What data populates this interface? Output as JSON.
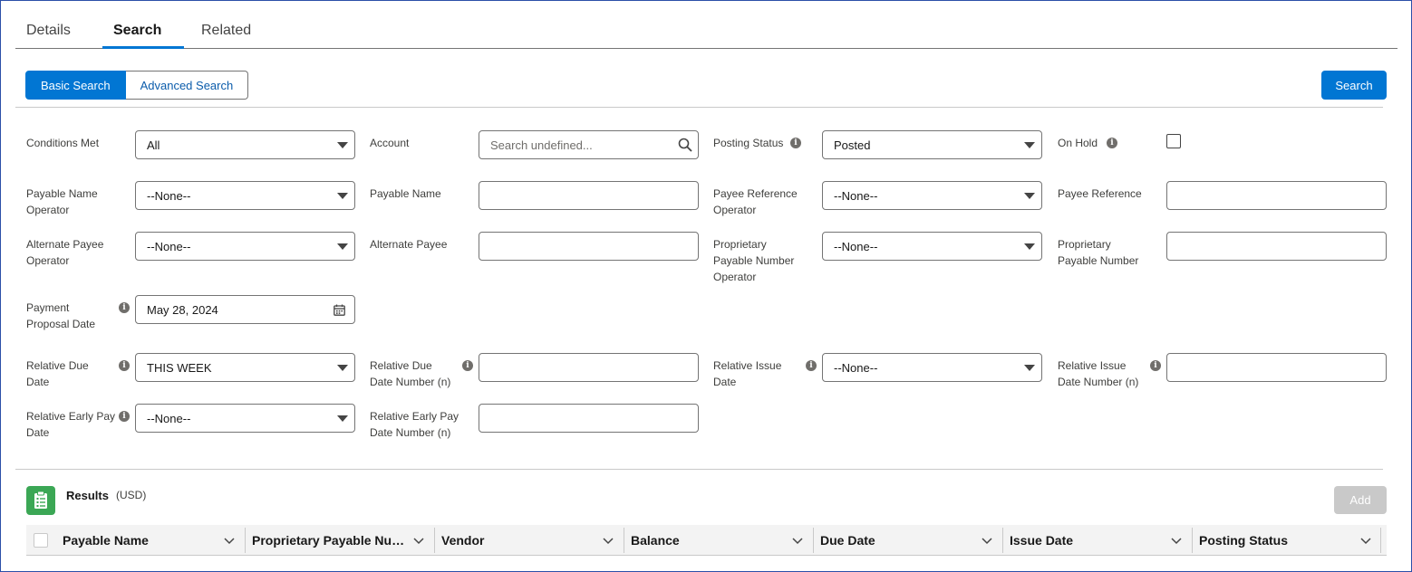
{
  "tabs": [
    {
      "label": "Details"
    },
    {
      "label": "Search"
    },
    {
      "label": "Related"
    }
  ],
  "mode": {
    "basic_label": "Basic Search",
    "advanced_label": "Advanced Search"
  },
  "search_button": "Search",
  "form": {
    "conditions_met": {
      "label": "Conditions Met",
      "value": "All"
    },
    "account": {
      "label": "Account",
      "placeholder": "Search undefined..."
    },
    "posting_status": {
      "label": "Posting Status",
      "value": "Posted"
    },
    "on_hold": {
      "label": "On Hold"
    },
    "payable_name_operator": {
      "label1": "Payable Name",
      "label2": "Operator",
      "value": "--None--"
    },
    "payable_name": {
      "label": "Payable Name",
      "value": ""
    },
    "payee_reference_operator": {
      "label1": "Payee Reference",
      "label2": "Operator",
      "value": "--None--"
    },
    "payee_reference": {
      "label": "Payee Reference",
      "value": ""
    },
    "alternate_payee_operator": {
      "label1": "Alternate Payee",
      "label2": "Operator",
      "value": "--None--"
    },
    "alternate_payee": {
      "label": "Alternate Payee",
      "value": ""
    },
    "proprietary_payable_number_operator": {
      "label1": "Proprietary",
      "label2": "Payable Number",
      "label3": "Operator",
      "value": "--None--"
    },
    "proprietary_payable_number": {
      "label1": "Proprietary",
      "label2": "Payable Number",
      "value": ""
    },
    "payment_proposal_date": {
      "label1": "Payment",
      "label2": "Proposal Date",
      "value": "May 28, 2024"
    },
    "relative_due_date": {
      "label1": "Relative Due",
      "label2": "Date",
      "value": "THIS WEEK"
    },
    "relative_due_date_number": {
      "label1": "Relative Due",
      "label2": "Date Number (n)",
      "value": ""
    },
    "relative_issue_date": {
      "label1": "Relative Issue",
      "label2": "Date",
      "value": "--None--"
    },
    "relative_issue_date_number": {
      "label1": "Relative Issue",
      "label2": "Date Number (n)",
      "value": ""
    },
    "relative_early_pay_date": {
      "label1": "Relative Early Pay",
      "label2": "Date",
      "value": "--None--"
    },
    "relative_early_pay_date_number": {
      "label1": "Relative Early Pay",
      "label2": "Date Number (n)",
      "value": ""
    }
  },
  "results": {
    "title": "Results",
    "currency": "(USD)",
    "add_label": "Add",
    "columns": [
      {
        "label": "Payable Name"
      },
      {
        "label": "Proprietary Payable Num..."
      },
      {
        "label": "Vendor"
      },
      {
        "label": "Balance"
      },
      {
        "label": "Due Date"
      },
      {
        "label": "Issue Date"
      },
      {
        "label": "Posting Status"
      }
    ]
  },
  "colors": {
    "brand": "#0176d3",
    "results_icon": "#3ba755",
    "disabled": "#c9c9c9"
  },
  "icons": [
    "search-icon",
    "calendar-icon",
    "info-icon",
    "clipboard-icon",
    "chevron-down-icon",
    "caret-down-icon"
  ]
}
